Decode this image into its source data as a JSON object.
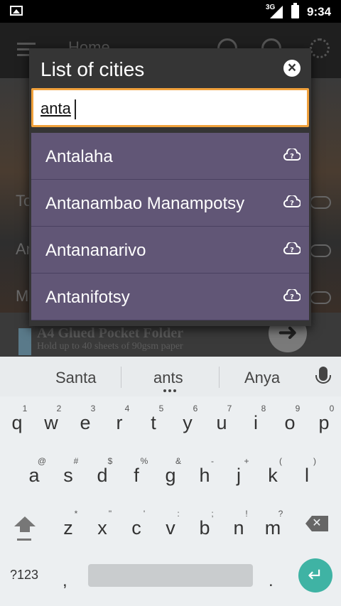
{
  "status_bar": {
    "network": "3G",
    "time": "9:34"
  },
  "app_background": {
    "title": "Home",
    "rows": [
      "To",
      "An",
      "M"
    ],
    "ad": {
      "title": "A4 Glued Pocket Folder",
      "subtitle": "Hold up to 40 sheets of 90gsm paper"
    }
  },
  "dialog": {
    "title": "List of cities",
    "search": {
      "value": "anta"
    },
    "cities": [
      {
        "name": "Antalaha",
        "icon": "cloud-question-icon"
      },
      {
        "name": "Antanambao Manampotsy",
        "icon": "cloud-question-icon"
      },
      {
        "name": "Antananarivo",
        "icon": "cloud-question-icon"
      },
      {
        "name": "Antanifotsy",
        "icon": "cloud-question-icon"
      }
    ],
    "accent_color": "#f0a13c",
    "item_color": "#615676"
  },
  "keyboard": {
    "suggestions": [
      "Santa",
      "ants",
      "Anya"
    ],
    "row1": [
      {
        "key": "q",
        "hint": "1"
      },
      {
        "key": "w",
        "hint": "2"
      },
      {
        "key": "e",
        "hint": "3"
      },
      {
        "key": "r",
        "hint": "4"
      },
      {
        "key": "t",
        "hint": "5"
      },
      {
        "key": "y",
        "hint": "6"
      },
      {
        "key": "u",
        "hint": "7"
      },
      {
        "key": "i",
        "hint": "8"
      },
      {
        "key": "o",
        "hint": "9"
      },
      {
        "key": "p",
        "hint": "0"
      }
    ],
    "row2": [
      {
        "key": "a",
        "hint": "@"
      },
      {
        "key": "s",
        "hint": "#"
      },
      {
        "key": "d",
        "hint": "$"
      },
      {
        "key": "f",
        "hint": "%"
      },
      {
        "key": "g",
        "hint": "&"
      },
      {
        "key": "h",
        "hint": "-"
      },
      {
        "key": "j",
        "hint": "+"
      },
      {
        "key": "k",
        "hint": "("
      },
      {
        "key": "l",
        "hint": ")"
      }
    ],
    "row3": [
      {
        "key": "z",
        "hint": "*"
      },
      {
        "key": "x",
        "hint": "\""
      },
      {
        "key": "c",
        "hint": "'"
      },
      {
        "key": "v",
        "hint": ":"
      },
      {
        "key": "b",
        "hint": ";"
      },
      {
        "key": "n",
        "hint": "!"
      },
      {
        "key": "m",
        "hint": "?"
      }
    ],
    "symbols_label": "?123",
    "comma": ",",
    "period": ".",
    "enter_color": "#3fb3a4"
  }
}
